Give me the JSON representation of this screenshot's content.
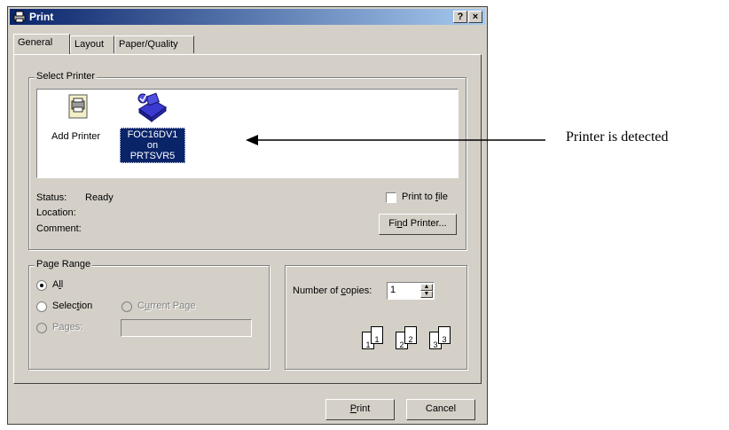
{
  "window": {
    "title": "Print",
    "help_btn": "?",
    "close_btn": "×"
  },
  "tabs": [
    {
      "label": "General"
    },
    {
      "label": "Layout"
    },
    {
      "label": "Paper/Quality"
    }
  ],
  "select_printer": {
    "group_label": "Select Printer",
    "printers": [
      {
        "label": "Add Printer",
        "icon": "add-printer-icon"
      },
      {
        "label_line1": "FOC16DV1 on",
        "label_line2": "PRTSVR5",
        "icon": "network-printer-icon",
        "selected": true
      }
    ],
    "status_label": "Status:",
    "status_value": "Ready",
    "location_label": "Location:",
    "comment_label": "Comment:",
    "print_to_file_pre": "Print to ",
    "print_to_file_u": "f",
    "print_to_file_post": "ile",
    "find_printer_pre": "Fi",
    "find_printer_u": "n",
    "find_printer_post": "d Printer..."
  },
  "page_range": {
    "group_label": "Page Range",
    "all_pre": "A",
    "all_u": "l",
    "all_post": "l",
    "selection_pre": "Selec",
    "selection_u": "t",
    "selection_post": "ion",
    "current_page_pre": "C",
    "current_page_u": "u",
    "current_page_post": "rrent Page",
    "pages_pre": "Pa",
    "pages_u": "g",
    "pages_post": "es:",
    "pages_value": ""
  },
  "copies": {
    "label_pre": "Number of ",
    "label_u": "c",
    "label_post": "opies:",
    "value": "1",
    "collate_labels": [
      "1",
      "1",
      "2",
      "2",
      "3",
      "3"
    ]
  },
  "buttons": {
    "print_u": "P",
    "print_post": "rint",
    "cancel": "Cancel"
  },
  "annotation": {
    "text": "Printer is detected"
  },
  "colors": {
    "dialog_face": "#d4d0c8",
    "title_start": "#0a246a",
    "title_end": "#a6caf0",
    "selection": "#0a246a"
  }
}
